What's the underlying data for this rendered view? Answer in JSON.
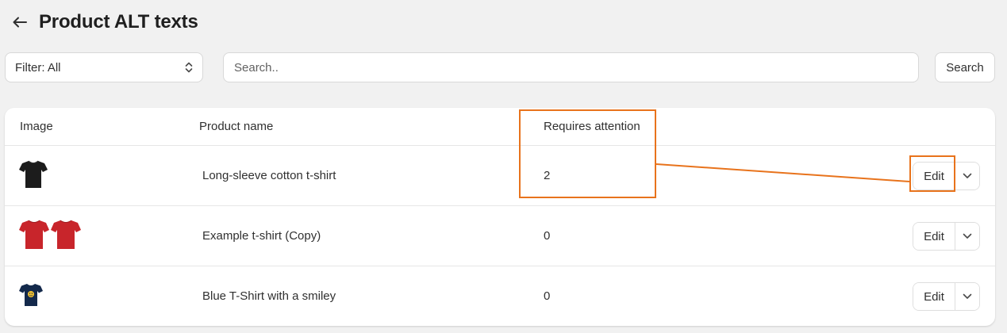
{
  "header": {
    "title": "Product ALT texts",
    "back_icon": "arrow-left-icon"
  },
  "toolbar": {
    "filter_label": "Filter: All",
    "search_placeholder": "Search..",
    "search_value": "",
    "search_button": "Search"
  },
  "table": {
    "columns": [
      "Image",
      "Product name",
      "Requires attention"
    ],
    "rows": [
      {
        "image": "black-tshirt-icon",
        "name": "Long-sleeve cotton t-shirt",
        "attention": "2",
        "edit": "Edit"
      },
      {
        "image": "red-tshirt-pair-icon",
        "name": "Example t-shirt (Copy)",
        "attention": "0",
        "edit": "Edit"
      },
      {
        "image": "navy-smiley-tshirt-icon",
        "name": "Blue T-Shirt with a smiley",
        "attention": "0",
        "edit": "Edit"
      }
    ]
  },
  "colors": {
    "background": "#f1f1f1",
    "annotation": "#e8731c",
    "shirt_black": "#1c1c1c",
    "shirt_red": "#c8252b",
    "shirt_navy": "#13294b"
  }
}
